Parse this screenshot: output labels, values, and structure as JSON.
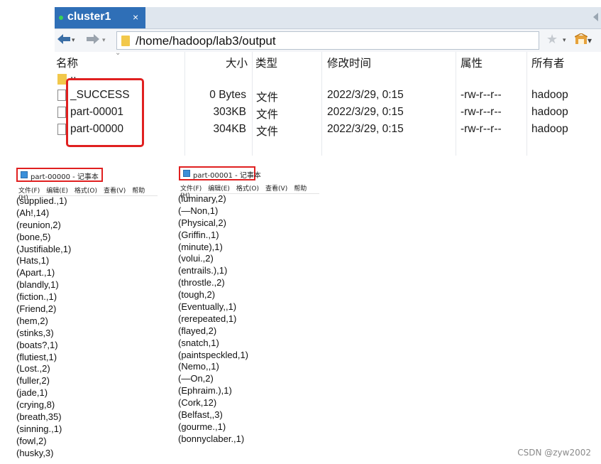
{
  "tab": {
    "title": "cluster1",
    "close_glyph": "×"
  },
  "toolbar": {
    "back_icon": "arrow-left-icon",
    "forward_icon": "arrow-right-icon",
    "path": "/home/hadoop/lab3/output",
    "dropdown_glyph": "▾",
    "star_glyph": "★"
  },
  "filelist": {
    "headers": {
      "name": "名称",
      "size": "大小",
      "type": "类型",
      "modified": "修改时间",
      "attributes": "属性",
      "owner": "所有者"
    },
    "rows": [
      {
        "name": "..",
        "size": "",
        "type": "",
        "modified": "",
        "attributes": "",
        "owner": "",
        "icon": "folder-icon"
      },
      {
        "name": "_SUCCESS",
        "size": "0 Bytes",
        "type": "文件",
        "modified": "2022/3/29, 0:15",
        "attributes": "-rw-r--r--",
        "owner": "hadoop",
        "icon": "file-icon"
      },
      {
        "name": "part-00001",
        "size": "303KB",
        "type": "文件",
        "modified": "2022/3/29, 0:15",
        "attributes": "-rw-r--r--",
        "owner": "hadoop",
        "icon": "file-icon"
      },
      {
        "name": "part-00000",
        "size": "304KB",
        "type": "文件",
        "modified": "2022/3/29, 0:15",
        "attributes": "-rw-r--r--",
        "owner": "hadoop",
        "icon": "file-icon"
      }
    ],
    "highlight_color": "#e02020"
  },
  "notepad_left": {
    "title": "part-00000 - 记事本",
    "menu": [
      "文件(F)",
      "编辑(E)",
      "格式(O)",
      "查看(V)",
      "帮助(H)"
    ],
    "lines": [
      "(supplied.,1)",
      "(Ah!,14)",
      "(reunion,2)",
      "(bone,5)",
      "(Justifiable,1)",
      "(Hats,1)",
      "(Apart.,1)",
      "(blandly,1)",
      "(fiction.,1)",
      "(Friend,2)",
      "(hem,2)",
      "(stinks,3)",
      "(boats?,1)",
      "(flutiest,1)",
      "(Lost.,2)",
      "(fuller,2)",
      "(jade,1)",
      "(crying,8)",
      "(breath,35)",
      "(sinning.,1)",
      "(fowl,2)",
      "(husky,3)"
    ]
  },
  "notepad_right": {
    "title": "part-00001 - 记事本",
    "menu": [
      "文件(F)",
      "编辑(E)",
      "格式(O)",
      "查看(V)",
      "帮助(H)"
    ],
    "lines": [
      "(luminary,2)",
      "(—Non,1)",
      "(Physical,2)",
      "(Griffin.,1)",
      "(minute),1)",
      "(volui.,2)",
      "(entrails.),1)",
      "(throstle.,2)",
      "(tough,2)",
      "(Eventually,,1)",
      "(rerepeated,1)",
      "(flayed,2)",
      "(snatch,1)",
      "(paintspeckled,1)",
      "(Nemo,,1)",
      "(—On,2)",
      "(Ephraim.),1)",
      "(Cork,12)",
      "(Belfast,,3)",
      "(gourme.,1)",
      "(bonnyclaber.,1)"
    ]
  },
  "watermark": "CSDN @zyw2002"
}
